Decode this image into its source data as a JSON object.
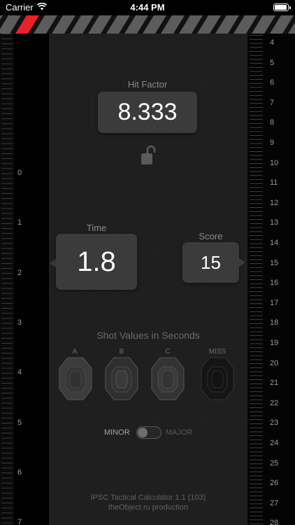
{
  "status_bar": {
    "carrier": "Carrier",
    "time": "4:44 PM"
  },
  "hit_factor": {
    "label": "Hit Factor",
    "value": "8.333",
    "lock_icon": "unlock-icon"
  },
  "time": {
    "label": "Time",
    "value": "1.8"
  },
  "score": {
    "label": "Score",
    "value": "15"
  },
  "shot_values": {
    "title": "Shot Values in Seconds",
    "targets": [
      {
        "label": "A"
      },
      {
        "label": "B"
      },
      {
        "label": "C"
      },
      {
        "label": "MISS"
      }
    ]
  },
  "power_factor": {
    "minor_label": "MINOR",
    "major_label": "MAJOR",
    "selected": "MINOR"
  },
  "left_ruler": {
    "labels": [
      "0",
      "1",
      "2",
      "3",
      "4",
      "5",
      "6",
      "7"
    ]
  },
  "right_ruler": {
    "labels": [
      "4",
      "5",
      "6",
      "7",
      "8",
      "9",
      "10",
      "11",
      "12",
      "13",
      "14",
      "15",
      "16",
      "17",
      "18",
      "19",
      "20",
      "21",
      "22",
      "23",
      "24",
      "25",
      "26",
      "27",
      "28"
    ]
  },
  "footer": {
    "line1": "IPSC Tactical Calculator 1.1 (103)",
    "line2": "theObject.ru production"
  },
  "colors": {
    "accent_stripe": "#e8212b",
    "box_bg": "#3b3b3b",
    "panel_bg": "#1d1d1d"
  }
}
